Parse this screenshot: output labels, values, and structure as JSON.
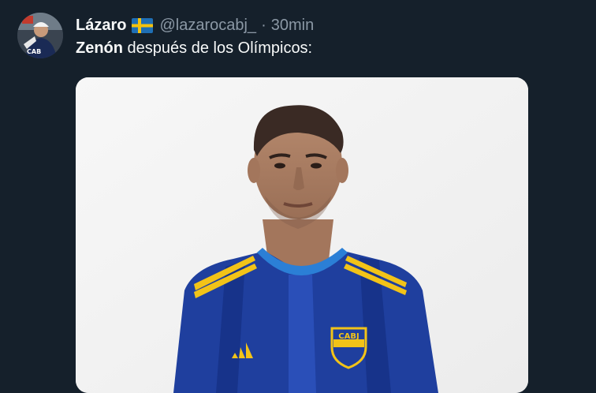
{
  "tweet": {
    "author_name": "Lázaro",
    "flag_icon": "sweden-flag-icon",
    "handle": "@lazarocabj_",
    "separator": "·",
    "time": "30min",
    "text_bold": "Zenón",
    "text_rest": " después de los Olímpicos:",
    "crest_text": "CABJ"
  },
  "colors": {
    "background": "#15202b",
    "text_primary": "#f7f9f9",
    "text_secondary": "#8b98a5",
    "jersey_blue": "#1f3f9e",
    "jersey_stripe": "#f2c318"
  }
}
